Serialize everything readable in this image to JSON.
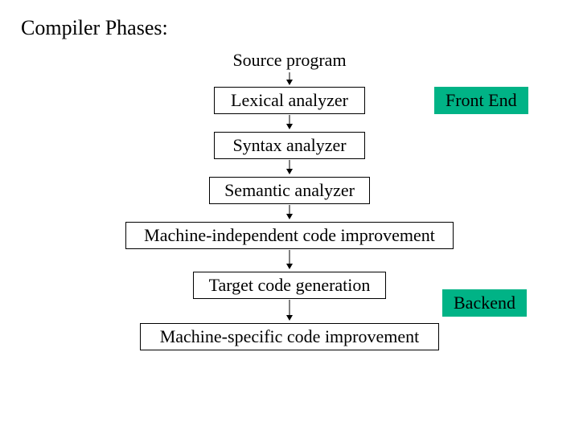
{
  "title": "Compiler Phases:",
  "source_label": "Source program",
  "phases": {
    "lexical": "Lexical analyzer",
    "syntax": "Syntax analyzer",
    "semantic": "Semantic analyzer",
    "mi_improve": "Machine-independent code improvement",
    "target_gen": "Target code generation",
    "ms_improve": "Machine-specific code improvement"
  },
  "badges": {
    "frontend": "Front End",
    "backend": "Backend"
  },
  "colors": {
    "badge_bg": "#00b386"
  }
}
